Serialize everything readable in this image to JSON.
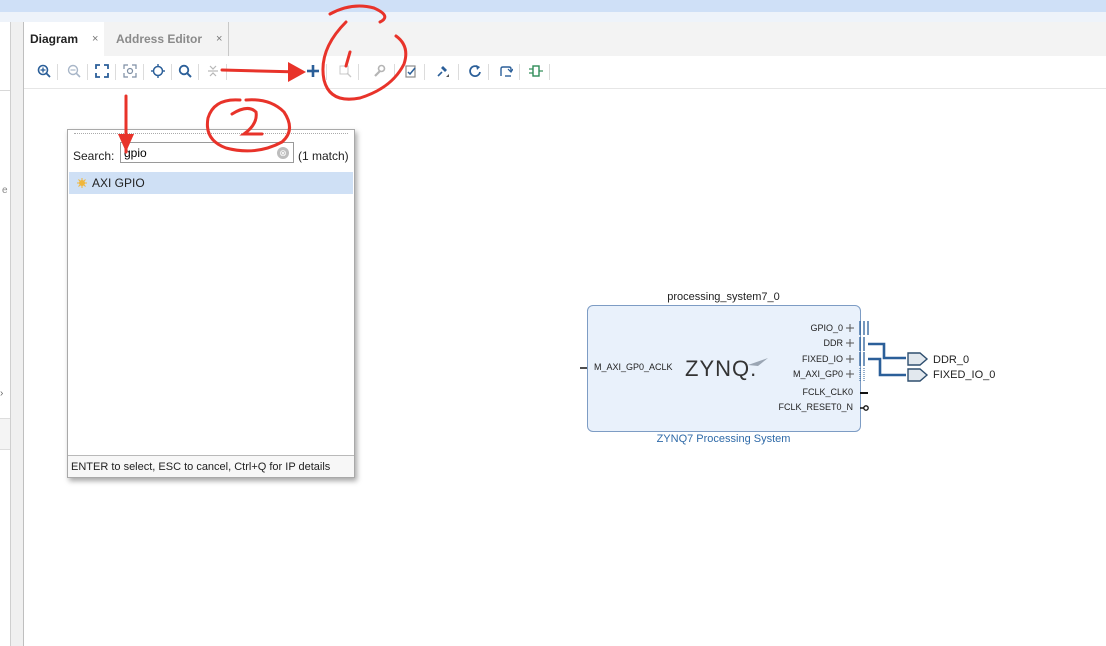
{
  "tabs": [
    {
      "label": "Diagram",
      "close": "×"
    },
    {
      "label": "Address Editor",
      "close": "×"
    }
  ],
  "toolbar_icons": [
    "zoom-in-icon",
    "zoom-out-icon",
    "fit-icon",
    "zoom-selection-icon",
    "center-icon",
    "search-icon",
    "collapse-icon",
    "add-ip-icon",
    "properties-icon",
    "settings-icon",
    "validate-icon",
    "pin-icon",
    "refresh-icon",
    "regenerate-icon",
    "port-icon"
  ],
  "popup": {
    "search_label": "Search:",
    "search_value": "gpio",
    "clear_icon": "⊗",
    "match_text": "(1 match)",
    "result": "AXI GPIO",
    "footer": "ENTER to select, ESC to cancel, Ctrl+Q for IP details"
  },
  "block": {
    "instance": "processing_system7_0",
    "logo": "ZYNQ.",
    "subtitle": "ZYNQ7 Processing System",
    "left_port": "M_AXI_GP0_ACLK",
    "right_ports": [
      "GPIO_0",
      "DDR",
      "FIXED_IO",
      "M_AXI_GP0",
      "FCLK_CLK0",
      "FCLK_RESET0_N"
    ],
    "external_ports": [
      "DDR_0",
      "FIXED_IO_0"
    ]
  },
  "left_panel": {
    "partial_char": "e",
    "arrow": "›"
  },
  "colors": {
    "annotation": "#e8332a",
    "accent": "#2f6aa8",
    "selection": "#cfe0f5",
    "block_fill": "#e9f1fb"
  }
}
